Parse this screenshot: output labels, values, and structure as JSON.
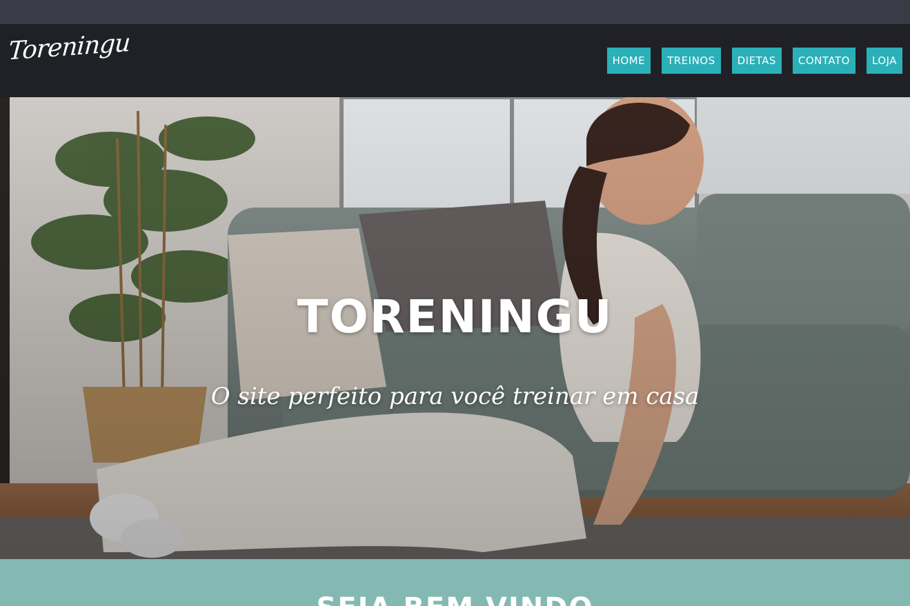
{
  "header": {
    "logo_text": "Toreningu"
  },
  "nav": {
    "items": [
      {
        "label": "HOME"
      },
      {
        "label": "TREINOS"
      },
      {
        "label": "DIETAS"
      },
      {
        "label": "CONTATO"
      },
      {
        "label": "LOJA"
      }
    ]
  },
  "hero": {
    "title": "TORENINGU",
    "subtitle": "O site perfeito para você treinar em casa"
  },
  "welcome": {
    "title": "SEJA BEM VINDO"
  },
  "colors": {
    "top_strip": "#393c46",
    "navbar": "#1f2126",
    "nav_button": "#2bb0b8",
    "welcome_section": "#84b9b3",
    "text": "#ffffff"
  }
}
